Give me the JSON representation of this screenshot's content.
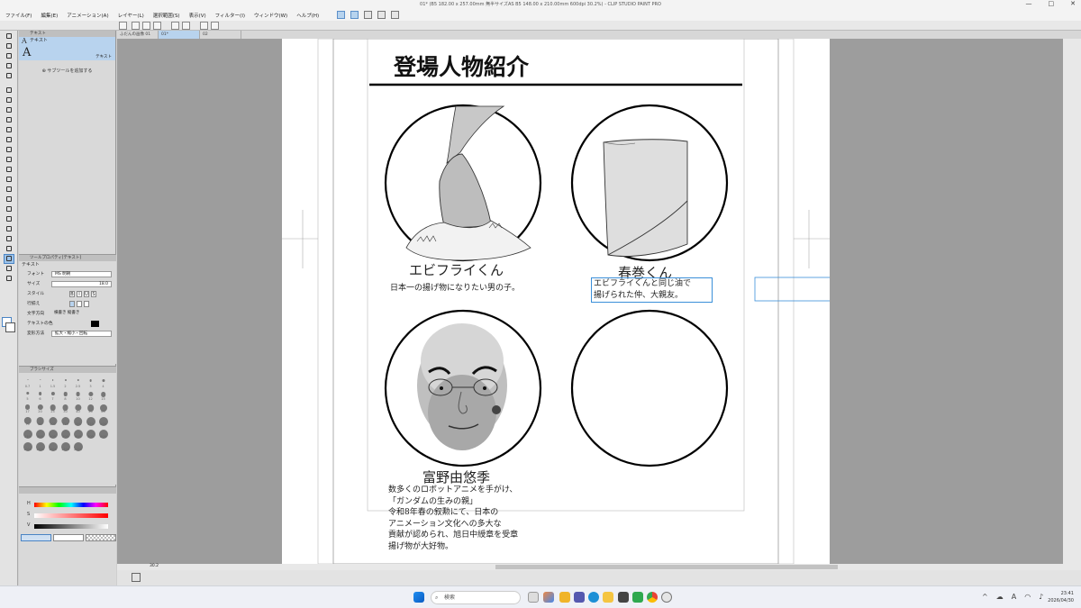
{
  "window": {
    "title": "01* (B5 182.00 x 257.00mm 無半サイズAS B5 148.00 x 210.00mm 600dpi 30.2%) - CLIP STUDIO PAINT PRO",
    "controls": [
      "—",
      "□",
      "✕"
    ]
  },
  "menu": {
    "items": [
      "ファイル(F)",
      "編集(E)",
      "アニメーション(A)",
      "レイヤー(L)",
      "選択範囲(S)",
      "表示(V)",
      "フィルター(I)",
      "ウィンドウ(W)",
      "ヘルプ(H)"
    ]
  },
  "tabs": [
    "ふだんの画像 01",
    "01*",
    "02"
  ],
  "subtool": {
    "header": "テキスト",
    "item_label": "テキスト",
    "big_label": "テキスト",
    "add_button": "サブツールを追加する"
  },
  "tool_property": {
    "header": "ツールプロパティ[テキスト]",
    "section": "テキスト",
    "rows": [
      {
        "label": "フォント",
        "value": "MS 明朝"
      },
      {
        "label": "サイズ",
        "value": "18.0"
      },
      {
        "label": "スタイル",
        "value": ""
      },
      {
        "label": "行揃え",
        "value": ""
      },
      {
        "label": "文字方向",
        "value": "横書き  縦書き"
      },
      {
        "label": "テキストの色",
        "value": ""
      },
      {
        "label": "変形方法",
        "value": "拡大・縮小・回転"
      }
    ],
    "style_buttons": [
      "B",
      "I",
      "U",
      "S"
    ]
  },
  "brush_size": {
    "header": "ブラシサイズ",
    "sizes": [
      "0.7",
      "1",
      "1.5",
      "2",
      "2.5",
      "3",
      "4",
      "5",
      "6",
      "7",
      "8",
      "10",
      "12",
      "15",
      "17",
      "20",
      "25",
      "30",
      "40",
      "50",
      "60",
      "70",
      "80",
      "100",
      "120",
      "150",
      "170",
      "200",
      "250",
      "300",
      "400",
      "500",
      "600",
      "700",
      "800",
      "1000",
      "1200",
      "1500",
      "1700",
      "2000"
    ]
  },
  "color": {
    "sliders": [
      {
        "label": "H",
        "value": "0"
      },
      {
        "label": "S",
        "value": "0"
      },
      {
        "label": "V",
        "value": "100"
      }
    ]
  },
  "manga_page": {
    "heading": "登場人物紹介",
    "characters": [
      {
        "name": "エビフライくん",
        "desc": [
          "日本一の揚げ物になりたい男の子。"
        ]
      },
      {
        "name": "春巻くん",
        "desc": [
          "エビフライくんと同じ油で",
          "揚げられた仲、大親友。"
        ]
      },
      {
        "name": "富野由悠季",
        "desc": [
          "数多くのロボットアニメを手がけ、",
          "「ガンダムの生みの親」",
          "令和8年春の叙勲にて、日本の",
          "アニメーション文化への多大な",
          "貢献が認められ、旭日中綬章を受章",
          "揚げ物が大好物。"
        ]
      },
      {
        "name": "",
        "desc": []
      }
    ]
  },
  "status": {
    "zoom": "30.2"
  },
  "taskbar": {
    "search_placeholder": "検索",
    "time": "23:41",
    "date": "2026/04/30",
    "lang": "A"
  }
}
